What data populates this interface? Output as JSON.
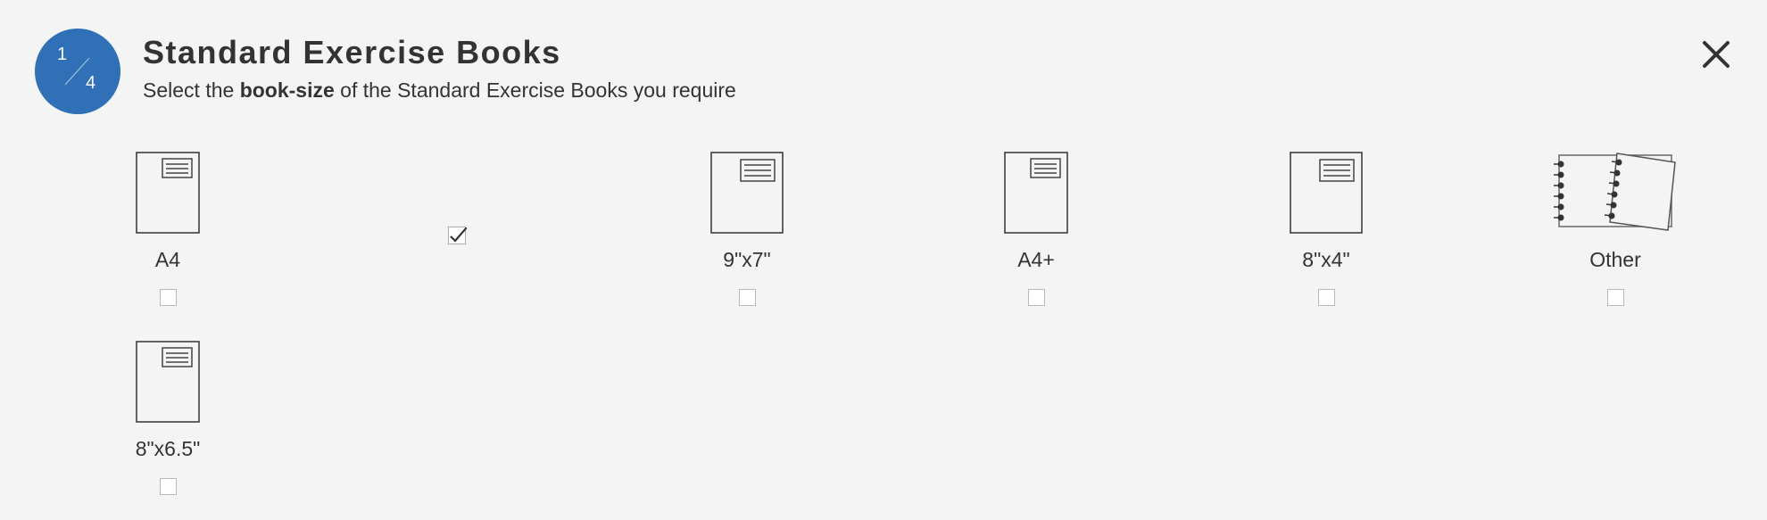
{
  "header": {
    "step_current": "1",
    "step_total": "4",
    "title": "Standard Exercise Books",
    "subtitle_pre": "Select the ",
    "subtitle_bold": "book-size",
    "subtitle_post": " of the Standard Exercise Books you require"
  },
  "colors": {
    "accent": "#2f70b7",
    "background": "#f4f4f4",
    "text": "#333333"
  },
  "options": [
    {
      "label": "A4",
      "icon": "exercise-book-icon",
      "checked": false
    },
    {
      "label": "9\"x7\"",
      "icon": "exercise-book-icon",
      "checked": false
    },
    {
      "label": "A4+",
      "icon": "exercise-book-icon",
      "checked": false
    },
    {
      "label": "8\"x4\"",
      "icon": "exercise-book-icon",
      "checked": false
    },
    {
      "label": "Other",
      "icon": "spiral-notebook-icon",
      "checked": false
    },
    {
      "label": "8\"x6.5\"",
      "icon": "exercise-book-icon",
      "checked": false
    }
  ],
  "stray_checkbox": {
    "checked": true
  }
}
